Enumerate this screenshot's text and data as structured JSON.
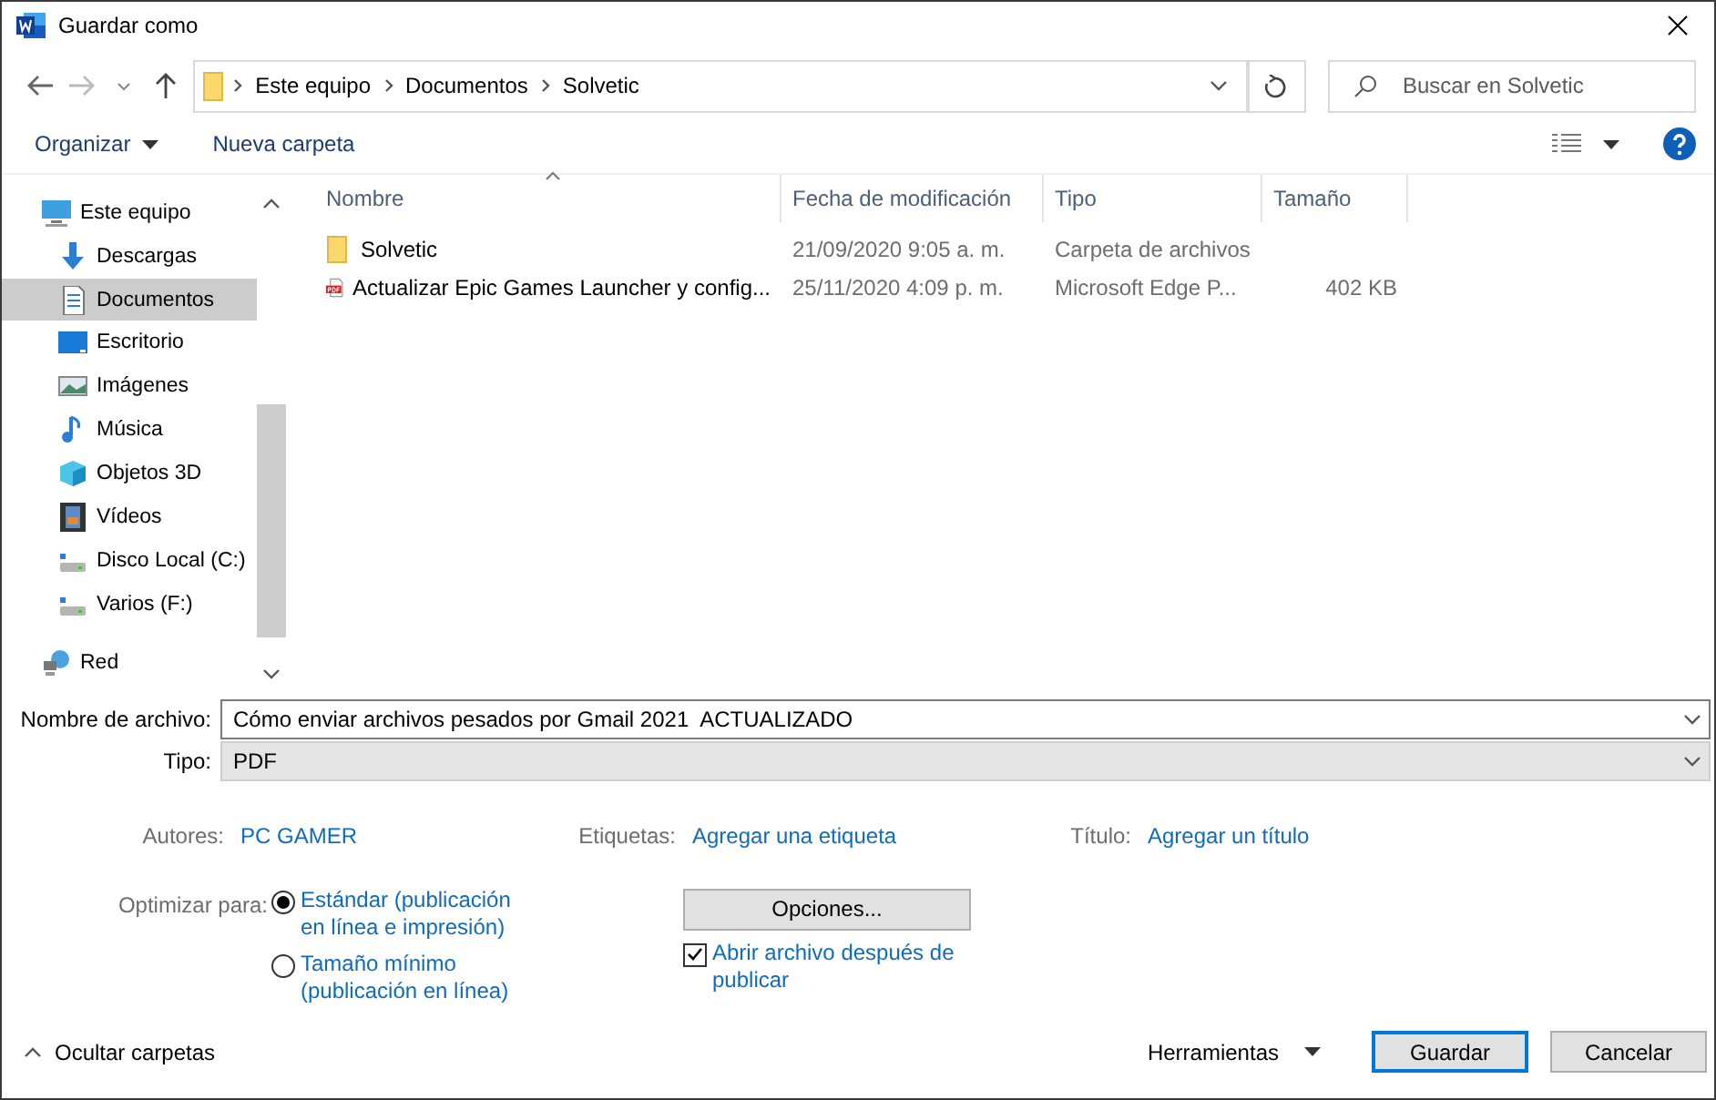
{
  "window": {
    "title": "Guardar como"
  },
  "address": {
    "path": [
      "Este equipo",
      "Documentos",
      "Solvetic"
    ]
  },
  "search": {
    "placeholder": "Buscar en Solvetic"
  },
  "toolbar": {
    "organize": "Organizar",
    "new_folder": "Nueva carpeta"
  },
  "sidebar": {
    "items": [
      {
        "label": "Este equipo",
        "selected": false,
        "children": [
          {
            "label": "Descargas",
            "selected": false
          },
          {
            "label": "Documentos",
            "selected": true
          },
          {
            "label": "Escritorio",
            "selected": false
          },
          {
            "label": "Imágenes",
            "selected": false
          },
          {
            "label": "Música",
            "selected": false
          },
          {
            "label": "Objetos 3D",
            "selected": false
          },
          {
            "label": "Vídeos",
            "selected": false
          },
          {
            "label": "Disco Local (C:)",
            "selected": false
          },
          {
            "label": "Varios (F:)",
            "selected": false
          }
        ]
      },
      {
        "label": "Red",
        "selected": false
      }
    ]
  },
  "table": {
    "columns": [
      "Nombre",
      "Fecha de modificación",
      "Tipo",
      "Tamaño"
    ],
    "rows": [
      {
        "kind": "folder",
        "name": "Solvetic",
        "date": "21/09/2020 9:05 a. m.",
        "type": "Carpeta de archivos"
      },
      {
        "kind": "pdf",
        "name": "Actualizar Epic Games Launcher y config...",
        "date": "25/11/2020 4:09 p. m.",
        "type": "Microsoft Edge P...",
        "size": "402 KB"
      }
    ]
  },
  "form": {
    "file_name": {
      "label": "Nombre de archivo:",
      "value": "Cómo enviar archivos pesados por Gmail 2021  ACTUALIZADO"
    },
    "file_type": {
      "label": "Tipo:",
      "value": "PDF"
    },
    "meta": [
      {
        "label": "Autores:",
        "value": "PC GAMER"
      },
      {
        "label": "Etiquetas:",
        "value": "Agregar una etiqueta"
      },
      {
        "label": "Título:",
        "value": "Agregar un título"
      }
    ],
    "optimize": {
      "label": "Optimizar para:",
      "options": [
        {
          "label": "Estándar (publicación en línea e impresión)",
          "selected": true
        },
        {
          "label": "Tamaño mínimo (publicación en línea)",
          "selected": false
        }
      ]
    },
    "options_button": "Opciones...",
    "open_after": {
      "label": "Abrir archivo después de publicar",
      "checked": true
    }
  },
  "footer": {
    "hide_folders": "Ocultar carpetas",
    "tools": "Herramientas",
    "buttons": [
      "Guardar",
      "Cancelar"
    ]
  }
}
